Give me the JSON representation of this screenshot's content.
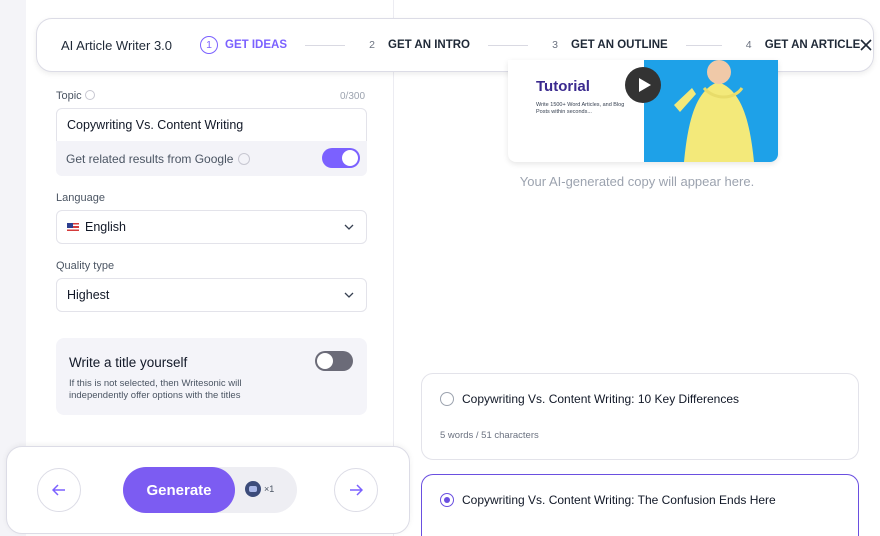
{
  "header": {
    "app_title": "AI Article Writer 3.0",
    "steps": [
      {
        "num": "1",
        "label": "GET IDEAS"
      },
      {
        "num": "2",
        "label": "GET AN INTRO"
      },
      {
        "num": "3",
        "label": "GET AN OUTLINE"
      },
      {
        "num": "4",
        "label": "GET AN ARTICLE"
      }
    ],
    "active_step": 1
  },
  "form": {
    "topic_label": "Topic",
    "topic_counter": "0/300",
    "topic_value": "Copywriting Vs. Content Writing",
    "google_label": "Get related results from Google",
    "google_toggle": "on",
    "language_label": "Language",
    "language_value": "English",
    "quality_label": "Quality type",
    "quality_value": "Highest",
    "title_card_heading": "Write a title yourself",
    "title_card_desc": "If this is not selected, then Writesonic will independently offer options with the titles",
    "title_toggle": "off"
  },
  "footer": {
    "generate_label": "Generate",
    "credit_text": "×1"
  },
  "preview": {
    "video_title": "Tutorial",
    "video_sub": "Write 1500+ Word Articles, and Blog Posts within seconds...",
    "placeholder": "Your AI-generated copy will appear here."
  },
  "options": [
    {
      "text": "Copywriting Vs. Content Writing: 10 Key Differences",
      "meta": "5 words / 51 characters",
      "selected": false
    },
    {
      "text": "Copywriting Vs. Content Writing: The Confusion Ends Here",
      "meta": "",
      "selected": true
    }
  ],
  "colors": {
    "accent": "#7b61ff",
    "generate": "#7c5cf2"
  }
}
